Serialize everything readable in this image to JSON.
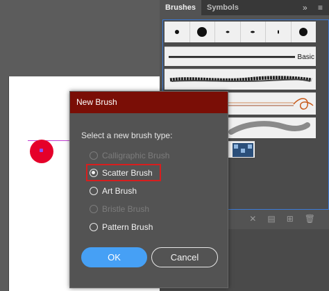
{
  "panel": {
    "tabs": [
      "Brushes",
      "Symbols"
    ],
    "more_icon": "double-chevron-right-icon",
    "menu_icon": "hamburger-menu-icon",
    "basic_label": "Basic",
    "bottom_icons": [
      "remove-brush-stroke-icon",
      "brush-options-icon",
      "new-brush-icon",
      "delete-brush-icon"
    ]
  },
  "dialog": {
    "title": "New Brush",
    "prompt": "Select a new brush type:",
    "options": [
      {
        "label": "Calligraphic Brush",
        "enabled": false,
        "selected": false
      },
      {
        "label": "Scatter Brush",
        "enabled": true,
        "selected": true
      },
      {
        "label": "Art Brush",
        "enabled": true,
        "selected": false
      },
      {
        "label": "Bristle Brush",
        "enabled": false,
        "selected": false
      },
      {
        "label": "Pattern Brush",
        "enabled": true,
        "selected": false
      }
    ],
    "ok_label": "OK",
    "cancel_label": "Cancel",
    "highlight_color": "#d81e1e",
    "title_bar_color": "#7a0e06",
    "ok_color": "#46a0f5"
  },
  "canvas": {
    "object_color": "#e5002a"
  }
}
